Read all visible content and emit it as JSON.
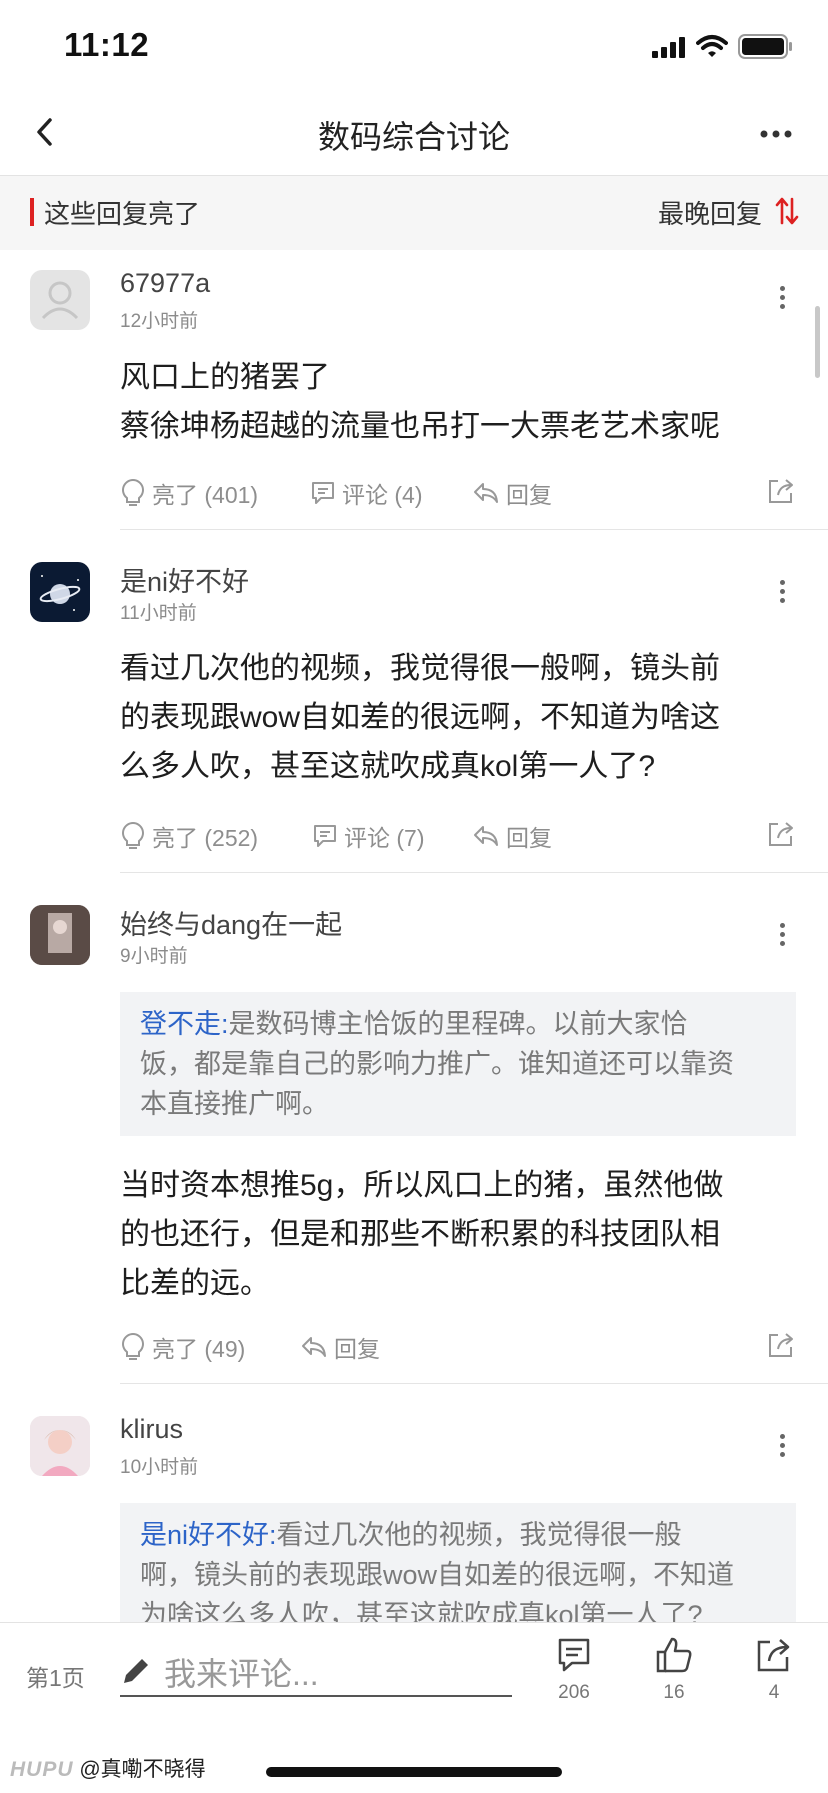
{
  "status_bar": {
    "time": "11:12"
  },
  "nav": {
    "title": "数码综合讨论"
  },
  "section": {
    "title": "这些回复亮了",
    "sort_label": "最晚回复"
  },
  "comments": [
    {
      "username": "67977a",
      "time": "12小时前",
      "content": [
        "风口上的猪罢了",
        "蔡徐坤杨超越的流量也吊打一大票老艺术家呢"
      ],
      "light": "亮了 (401)",
      "comment": "评论 (4)",
      "reply": "回复"
    },
    {
      "username": "是ni好不好",
      "time": "11小时前",
      "content": [
        "看过几次他的视频，我觉得很一般啊，镜头前",
        "的表现跟wow自如差的很远啊，不知道为啥这",
        "么多人吹，甚至这就吹成真kol第一人了?"
      ],
      "light": "亮了 (252)",
      "comment": "评论 (7)",
      "reply": "回复"
    },
    {
      "username": "始终与dang在一起",
      "time": "9小时前",
      "quote_name": "登不走:",
      "quote_text": [
        "是数码博主恰饭的里程碑。以前大家恰",
        "饭，都是靠自己的影响力推广。谁知道还可以靠资",
        "本直接推广啊。"
      ],
      "content": [
        "当时资本想推5g，所以风口上的猪，虽然他做",
        "的也还行，但是和那些不断积累的科技团队相",
        "比差的远。"
      ],
      "light": "亮了 (49)",
      "reply": "回复"
    },
    {
      "username": "klirus",
      "time": "10小时前",
      "quote_name": "是ni好不好:",
      "quote_text": [
        "看过几次他的视频，我觉得很一般",
        "啊，镜头前的表现跟wow自如差的很远啊，不知道",
        "为啥这么多人吹，甚至这就吹成真kol第一人了?"
      ]
    }
  ],
  "bottom_bar": {
    "page_label": "第1页",
    "input_placeholder": "我来评论...",
    "comments_count": "206",
    "likes_count": "16",
    "shares_count": "4"
  },
  "watermark": {
    "logo": "HUPU",
    "text": "@真嘞不晓得"
  },
  "colors": {
    "accent_red": "#dd2222",
    "quote_blue": "#2d64c8",
    "header_bg": "#f6f6f6"
  }
}
